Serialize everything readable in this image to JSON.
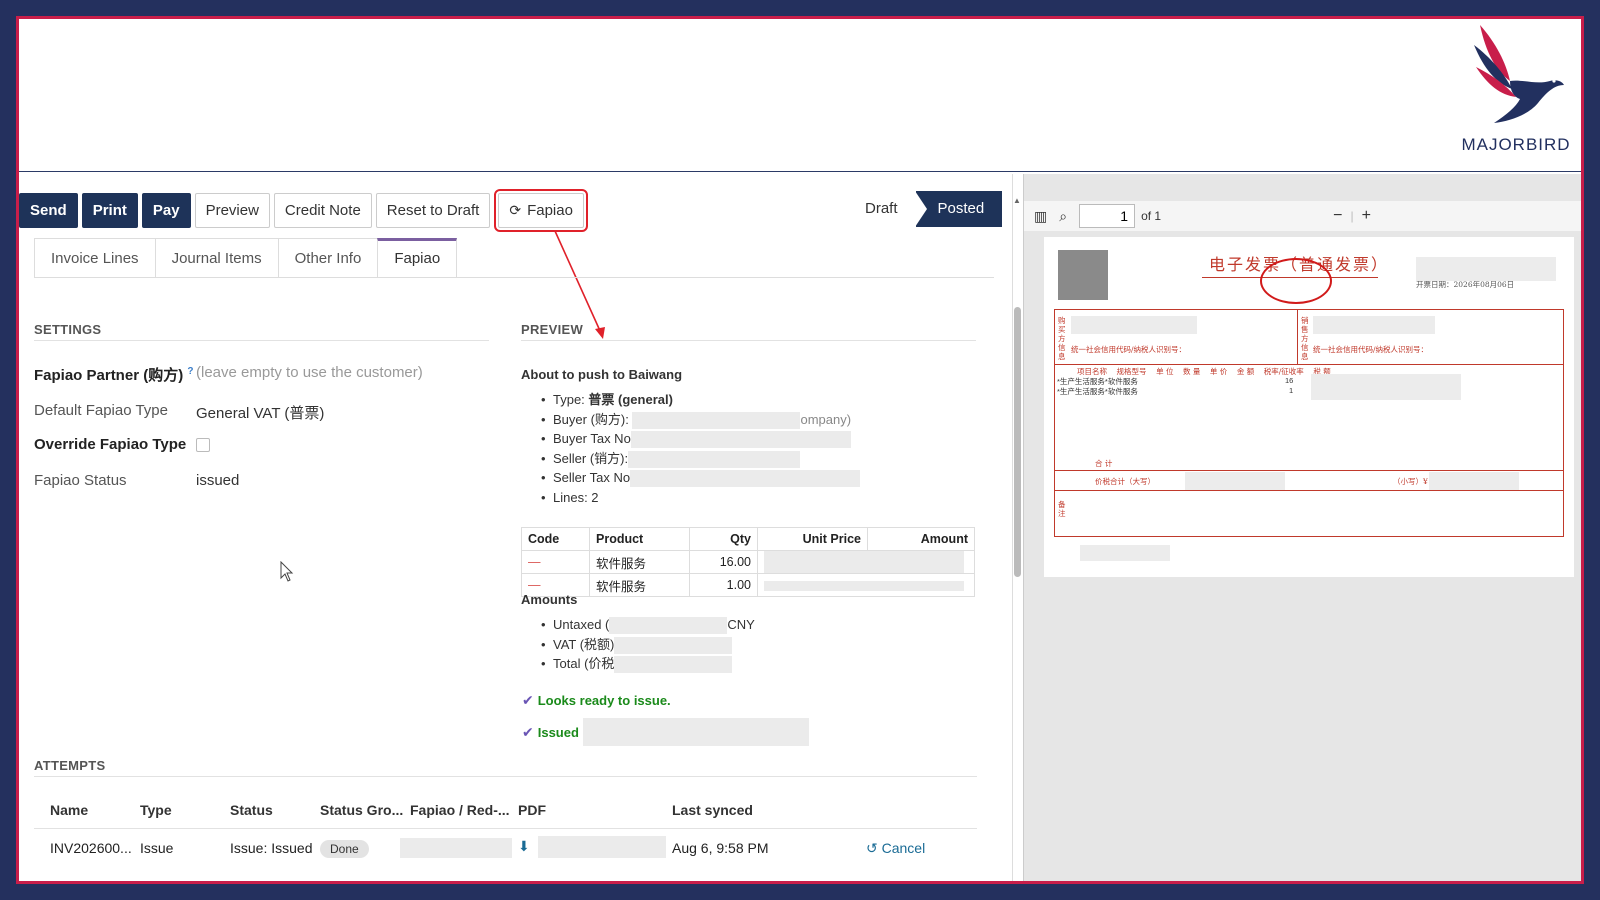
{
  "brand": {
    "name": "MAJORBIRD"
  },
  "toolbar": {
    "send": "Send",
    "print": "Print",
    "pay": "Pay",
    "preview": "Preview",
    "credit_note": "Credit Note",
    "reset_to_draft": "Reset to Draft",
    "fapiao": "Fapiao"
  },
  "status": {
    "draft": "Draft",
    "posted": "Posted"
  },
  "tabs": [
    "Invoice Lines",
    "Journal Items",
    "Other Info",
    "Fapiao"
  ],
  "settings": {
    "title": "SETTINGS",
    "partner_label": "Fapiao Partner (购方)",
    "partner_help": "?",
    "partner_placeholder": "(leave empty to use the customer)",
    "default_type_label": "Default Fapiao Type",
    "default_type_value": "General VAT (普票)",
    "override_label": "Override Fapiao Type",
    "status_label": "Fapiao Status",
    "status_value": "issued"
  },
  "preview": {
    "title": "PREVIEW",
    "heading": "About to push to Baiwang",
    "type_label": "Type: ",
    "type_value": "普票 (general)",
    "buyer_label": "Buyer (购方):",
    "buyer_tail": "ompany)",
    "buyer_tax_label": "Buyer Tax No",
    "seller_label": "Seller (销方):",
    "seller_tax_label": "Seller Tax No",
    "lines_label": "Lines: 2",
    "table_headers": [
      "Code",
      "Product",
      "Qty",
      "Unit Price",
      "Amount"
    ],
    "rows": [
      {
        "code": "—",
        "product": "软件服务",
        "qty": "16.00"
      },
      {
        "code": "—",
        "product": "软件服务",
        "qty": "1.00"
      }
    ],
    "amounts_heading": "Amounts",
    "untaxed_label": "Untaxed (",
    "untaxed_tail": "CNY",
    "vat_label": "VAT (税额)",
    "total_label": "Total (价税",
    "ready_msg": "Looks ready to issue.",
    "issued_msg": "Issued"
  },
  "attempts": {
    "title": "ATTEMPTS",
    "headers": [
      "Name",
      "Type",
      "Status",
      "Status Gro...",
      "Fapiao / Red-...",
      "PDF",
      "Last synced"
    ],
    "row": {
      "name": "INV202600...",
      "type": "Issue",
      "status": "Issue: Issued",
      "group": "Done",
      "last_synced": "Aug 6, 9:58 PM",
      "cancel": "Cancel"
    }
  },
  "pdf": {
    "page_value": "1",
    "page_total": "of 1",
    "invoice_title": "电子发票（普通发票）",
    "date_text": "开票日期：2026年08月06日",
    "buyer_side": "购买方信息",
    "seller_side": "销售方信息",
    "tax_id_label": "统一社会信用代码/纳税人识别号：",
    "columns": "项目名称    规格型号    单 位    数 量    单 价    金 额    税率/征收率    税 额",
    "item1": "*生产生活服务*软件服务",
    "item2": "*生产生活服务*软件服务",
    "qty1": "16",
    "qty2": "1",
    "subtotal_label": "合      计",
    "total_label": "价税合计（大写）",
    "total_small": "（小写）¥",
    "remarks": "备注"
  }
}
